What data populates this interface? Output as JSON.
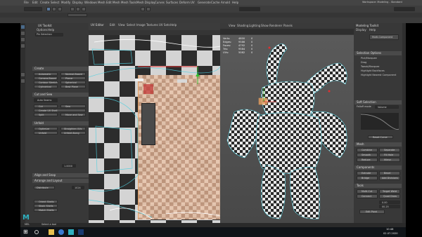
{
  "window": {
    "title_menu": [
      "File",
      "Edit",
      "Create",
      "Select",
      "Modify",
      "Display",
      "Windows",
      "Mesh",
      "Edit Mesh",
      "Mesh Tools",
      "Mesh Display",
      "Curves",
      "Surfaces",
      "Deform",
      "UV",
      "Generate",
      "Cache",
      "Arnold",
      "Help"
    ],
    "workspace_label": "Workspace: Modeling - Standard"
  },
  "uv_editor": {
    "title": "UV Editor",
    "menu": [
      "Edit",
      "View",
      "Select",
      "Image",
      "Textures",
      "UV Sets",
      "Help"
    ]
  },
  "uv_toolkit": {
    "title": "UV Toolkit",
    "menu": [
      "Options",
      "Help"
    ],
    "tool_label": "Pin Selection",
    "sections": [
      {
        "title": "Create",
        "items": [
          "Automatic",
          "Camera-Based",
          "Contour Stretch",
          "Cylindrical",
          "Normal-Based",
          "Planar",
          "Spherical",
          "Best Plane"
        ]
      },
      {
        "title": "Cut and Sew",
        "items": [
          "Auto Seams",
          "Cut",
          "Sew",
          "Create UV Shell",
          "Split",
          "Move and Sew"
        ]
      },
      {
        "title": "Unfold",
        "items": [
          "Optimize",
          "Straighten UVs",
          "Unfold",
          "Unfold Along"
        ]
      },
      {
        "title": "Align and Snap",
        "items": []
      },
      {
        "title": "Arrange and Layout",
        "items": [
          "Distribute",
          "Orient Shells",
          "Stack Shells",
          "Match Shells",
          "Layout"
        ]
      }
    ],
    "fields": {
      "iterations": "1.0000",
      "size": "1024"
    }
  },
  "viewport": {
    "menu": [
      "View",
      "Shading",
      "Lighting",
      "Show",
      "Renderer",
      "Panels"
    ],
    "hud": {
      "rows": [
        {
          "label": "Verts:",
          "a": "4800",
          "b": "0"
        },
        {
          "label": "Edges:",
          "a": "9586",
          "b": "0"
        },
        {
          "label": "Faces:",
          "a": "4792",
          "b": "0"
        },
        {
          "label": "Tris:",
          "a": "9584",
          "b": "0"
        },
        {
          "label": "UVs:",
          "a": "5082",
          "b": "0"
        }
      ]
    }
  },
  "modeling_toolkit": {
    "title": "Modeling Toolkit",
    "menu": [
      "Display",
      "Help"
    ],
    "object_label": "Multi-Component",
    "sections": [
      "Selection Options",
      "Soft Selection",
      "Mesh",
      "Components",
      "Tools"
    ],
    "checkboxes": [
      "Pick/Marquee",
      "Drag",
      "Tweak/Marquee",
      "Highlight Backfaces",
      "Highlight Nearest Component"
    ],
    "buttons": [
      "Combine",
      "Separate",
      "Smooth",
      "Fill Hole",
      "Reduce",
      "Mirror",
      "Extrude",
      "Bevel",
      "Bridge",
      "Add Divisions",
      "Multi-Cut",
      "Target Weld",
      "Connect",
      "Quad Draw"
    ],
    "falloff_label": "Falloff mode",
    "falloff_value": "Volume",
    "reset_label": "Reset Curve",
    "fields": {
      "width": "0.00",
      "height": "00.25"
    },
    "edit_button": "Edit Pivot"
  },
  "statusline": {
    "left": "MEL",
    "message": "Select a tool"
  },
  "taskbar": {
    "time": "10:48",
    "date": "02.07.2020"
  },
  "colors": {
    "accent": "#3ea0d0",
    "maya_teal": "#2fb0c0",
    "selection_orange": "#e8a060",
    "uv_wire": "#4fd0e0"
  }
}
